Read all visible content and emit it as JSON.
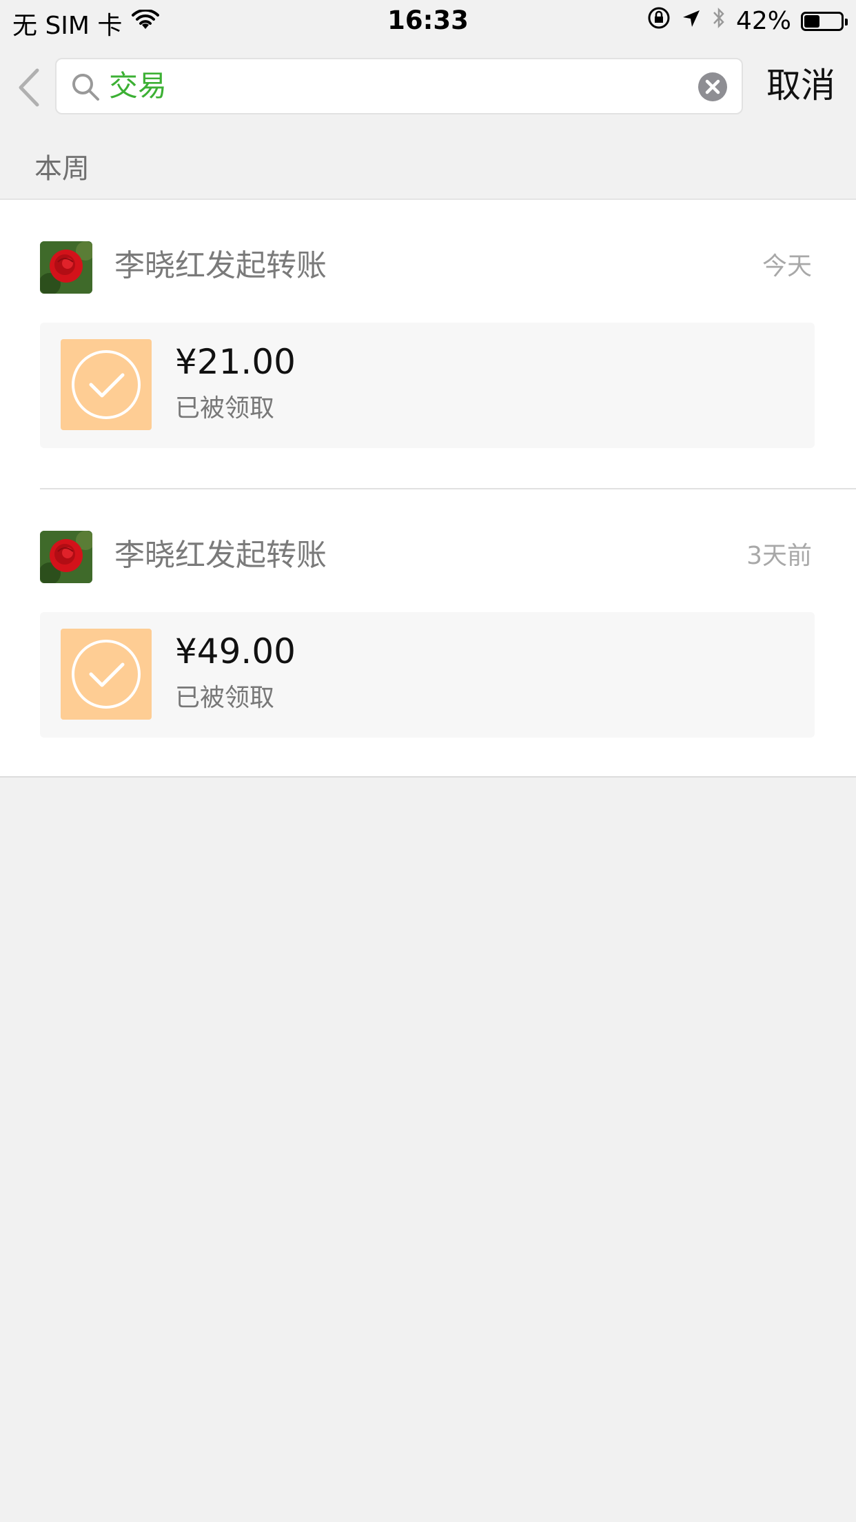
{
  "status_bar": {
    "carrier": "无 SIM 卡",
    "time": "16:33",
    "battery_percent": "42%",
    "battery_level": 0.42,
    "icons": [
      "wifi-icon",
      "rotation-lock-icon",
      "location-arrow-icon",
      "bluetooth-icon",
      "battery-icon"
    ]
  },
  "search": {
    "query": "交易",
    "cancel_label": "取消"
  },
  "section": {
    "header": "本周"
  },
  "results": [
    {
      "title": "李晓红发起转账",
      "time": "今天",
      "amount": "¥21.00",
      "status": "已被领取"
    },
    {
      "title": "李晓红发起转账",
      "time": "3天前",
      "amount": "¥49.00",
      "status": "已被领取"
    }
  ],
  "colors": {
    "accent_green": "#3cb034",
    "card_icon_bg": "#fecd94",
    "page_bg": "#f1f1f1"
  }
}
